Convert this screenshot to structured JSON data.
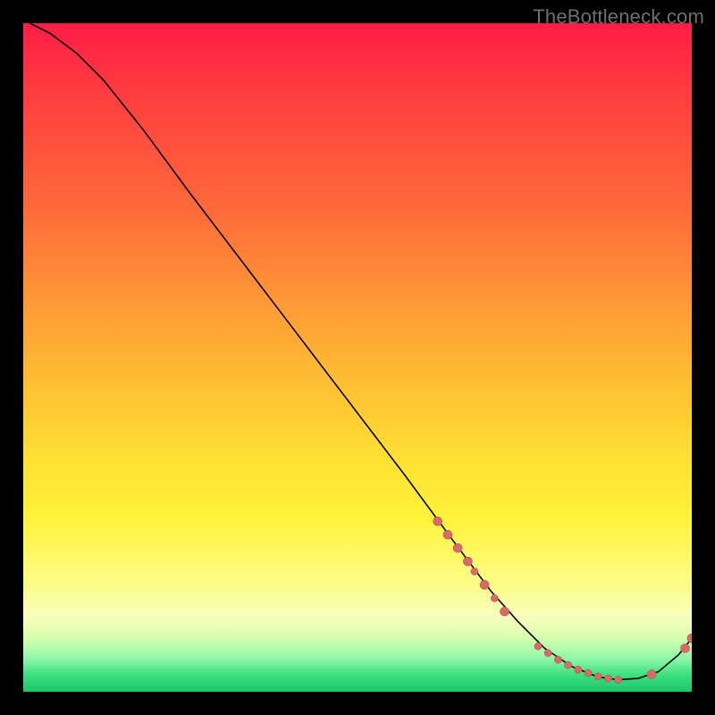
{
  "watermark": "TheBottleneck.com",
  "chart_data": {
    "type": "line",
    "title": "",
    "xlabel": "",
    "ylabel": "",
    "xlim": [
      0,
      100
    ],
    "ylim": [
      0,
      100
    ],
    "grid": false,
    "legend": false,
    "series": [
      {
        "name": "bottleneck-curve",
        "x": [
          1,
          4,
          8,
          12,
          18,
          25,
          33,
          41,
          49,
          57,
          64,
          70,
          74,
          78,
          82,
          86,
          89,
          92,
          95,
          98,
          100
        ],
        "y": [
          100,
          98.5,
          95.5,
          91.5,
          84,
          74.5,
          64,
          53.5,
          43,
          32.5,
          23,
          15,
          10.5,
          6.5,
          3.8,
          2.2,
          1.8,
          2.0,
          3.0,
          5.5,
          8
        ]
      }
    ],
    "markers": [
      {
        "name": "cluster-descent",
        "points": [
          {
            "x": 62,
            "y": 25.5,
            "r": 5
          },
          {
            "x": 63.5,
            "y": 23.5,
            "r": 5
          },
          {
            "x": 65,
            "y": 21.5,
            "r": 5
          },
          {
            "x": 66.5,
            "y": 19.5,
            "r": 5
          },
          {
            "x": 67.5,
            "y": 18.0,
            "r": 4
          },
          {
            "x": 69,
            "y": 16.0,
            "r": 5
          },
          {
            "x": 70.5,
            "y": 14.0,
            "r": 4
          },
          {
            "x": 72,
            "y": 12.0,
            "r": 5
          }
        ]
      },
      {
        "name": "cluster-valley",
        "points": [
          {
            "x": 77,
            "y": 6.8,
            "r": 4
          },
          {
            "x": 78.5,
            "y": 5.8,
            "r": 4
          },
          {
            "x": 80,
            "y": 4.8,
            "r": 4
          },
          {
            "x": 81.5,
            "y": 4.0,
            "r": 4
          },
          {
            "x": 83,
            "y": 3.3,
            "r": 4
          },
          {
            "x": 84.5,
            "y": 2.8,
            "r": 4
          },
          {
            "x": 86,
            "y": 2.3,
            "r": 4
          },
          {
            "x": 87.5,
            "y": 2.0,
            "r": 4
          },
          {
            "x": 89,
            "y": 1.8,
            "r": 4
          }
        ]
      },
      {
        "name": "cluster-upturn",
        "points": [
          {
            "x": 94,
            "y": 2.6,
            "r": 5
          },
          {
            "x": 99,
            "y": 6.5,
            "r": 5
          },
          {
            "x": 100,
            "y": 8.0,
            "r": 5
          }
        ]
      }
    ],
    "colors": {
      "curve": "#000000",
      "marker_fill": "#d96a6a",
      "marker_stroke": "#b85555"
    }
  }
}
